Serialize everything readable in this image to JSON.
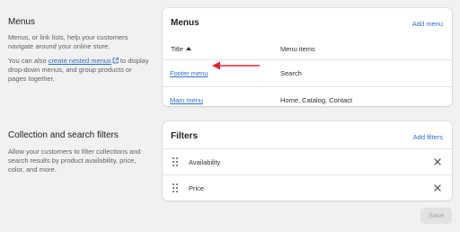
{
  "menus_section": {
    "title": "Menus",
    "desc1": "Menus, or link lists, help your customers navigate around your online store.",
    "desc2_before": "You can also ",
    "desc2_link": "create nested menus",
    "desc2_after": " to display drop-down menus, and group products or pages together."
  },
  "menus_card": {
    "title": "Menus",
    "action": "Add menu",
    "col_title": "Title",
    "col_items": "Menu items",
    "rows": [
      {
        "title": "Footer menu",
        "items": "Search"
      },
      {
        "title": "Main menu",
        "items": "Home, Catalog, Contact"
      }
    ]
  },
  "filters_section": {
    "title": "Collection and search filters",
    "desc": "Allow your customers to filter collections and search results by product availability, price, color, and more."
  },
  "filters_card": {
    "title": "Filters",
    "action": "Add filters",
    "rows": [
      {
        "label": "Availability"
      },
      {
        "label": "Price"
      }
    ]
  },
  "save_label": "Save",
  "colors": {
    "link": "#2c6ecb",
    "arrow": "#e0292e",
    "background": "#f1f1f1"
  },
  "icons": [
    "sort-asc-icon",
    "external-link-icon",
    "drag-handle-icon",
    "close-icon",
    "red-arrow-annotation"
  ]
}
